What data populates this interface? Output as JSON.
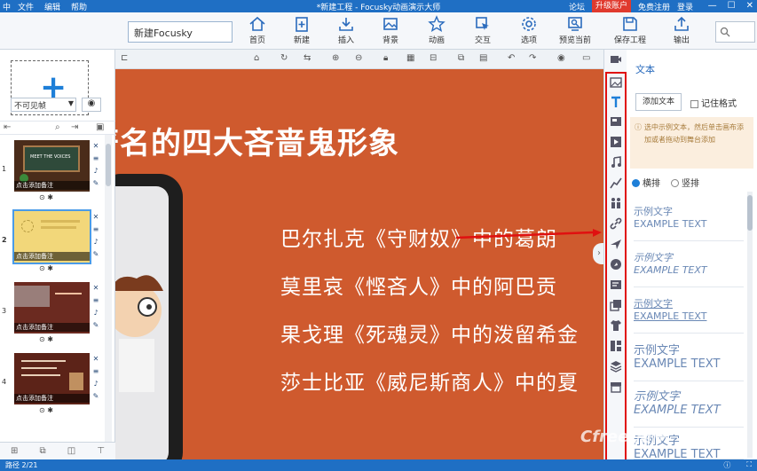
{
  "titlebar": {
    "logo": "中",
    "menu": [
      "文件",
      "编辑",
      "帮助"
    ],
    "title": "*新建工程 - Focusky动画演示大师",
    "forum": "论坛",
    "upgrade": "升级账户",
    "register": "免费注册",
    "login": "登录"
  },
  "toolbar": {
    "project_name": "新建Focusky",
    "buttons": [
      {
        "label": "首页",
        "icon": "home-icon"
      },
      {
        "label": "新建",
        "icon": "new-file-icon"
      },
      {
        "label": "插入",
        "icon": "insert-icon"
      },
      {
        "label": "背景",
        "icon": "background-icon"
      },
      {
        "label": "动画",
        "icon": "animation-icon"
      },
      {
        "label": "交互",
        "icon": "interaction-icon"
      },
      {
        "label": "选项",
        "icon": "gear-icon"
      },
      {
        "label": "预览当前",
        "icon": "preview-icon"
      },
      {
        "label": "保存工程",
        "icon": "save-icon"
      },
      {
        "label": "输出",
        "icon": "export-icon"
      }
    ]
  },
  "left_panel": {
    "visibility": "不可见帧",
    "slides": [
      {
        "num": "1",
        "note": "点击添加备注",
        "selected": false
      },
      {
        "num": "2",
        "note": "点击添加备注",
        "selected": true
      },
      {
        "num": "3",
        "note": "点击添加备注",
        "selected": false
      },
      {
        "num": "4",
        "note": "点击添加备注",
        "selected": false
      }
    ],
    "thumb1_text": "MEET THE VOICES"
  },
  "canvas": {
    "heading": "著名的四大吝啬鬼形象",
    "lines": [
      "巴尔扎克《守财奴》中的葛朗",
      "莫里哀《悭吝人》中的阿巴贡",
      "果戈理《死魂灵》中的泼留希金",
      "莎士比亚《威尼斯商人》中的夏"
    ]
  },
  "right_panel": {
    "title": "文本",
    "add_text": "添加文本",
    "remember_format": "记住格式",
    "tip": "选中示例文本，然后单击画布添加或者拖动到舞台添加",
    "horizontal": "横排",
    "vertical": "竖排",
    "samples": [
      {
        "cn": "示例文字",
        "en": "EXAMPLE TEXT"
      },
      {
        "cn": "示例文字",
        "en": "EXAMPLE TEXT"
      },
      {
        "cn": "示例文字",
        "en": "EXAMPLE TEXT"
      },
      {
        "cn": "示例文字",
        "en": "EXAMPLE TEXT"
      },
      {
        "cn": "示例文字",
        "en": "EXAMPLE TEXT"
      },
      {
        "cn": "示例文字",
        "en": "EXAMPLE TEXT"
      }
    ]
  },
  "statusbar": {
    "path": "路径 2/21"
  },
  "watermark": "Cfree 插件",
  "colors": {
    "accent": "#1f6fc4",
    "canvas_bg": "#cf5a2e",
    "highlight": "#e01010",
    "upgrade": "#e03a2e"
  }
}
